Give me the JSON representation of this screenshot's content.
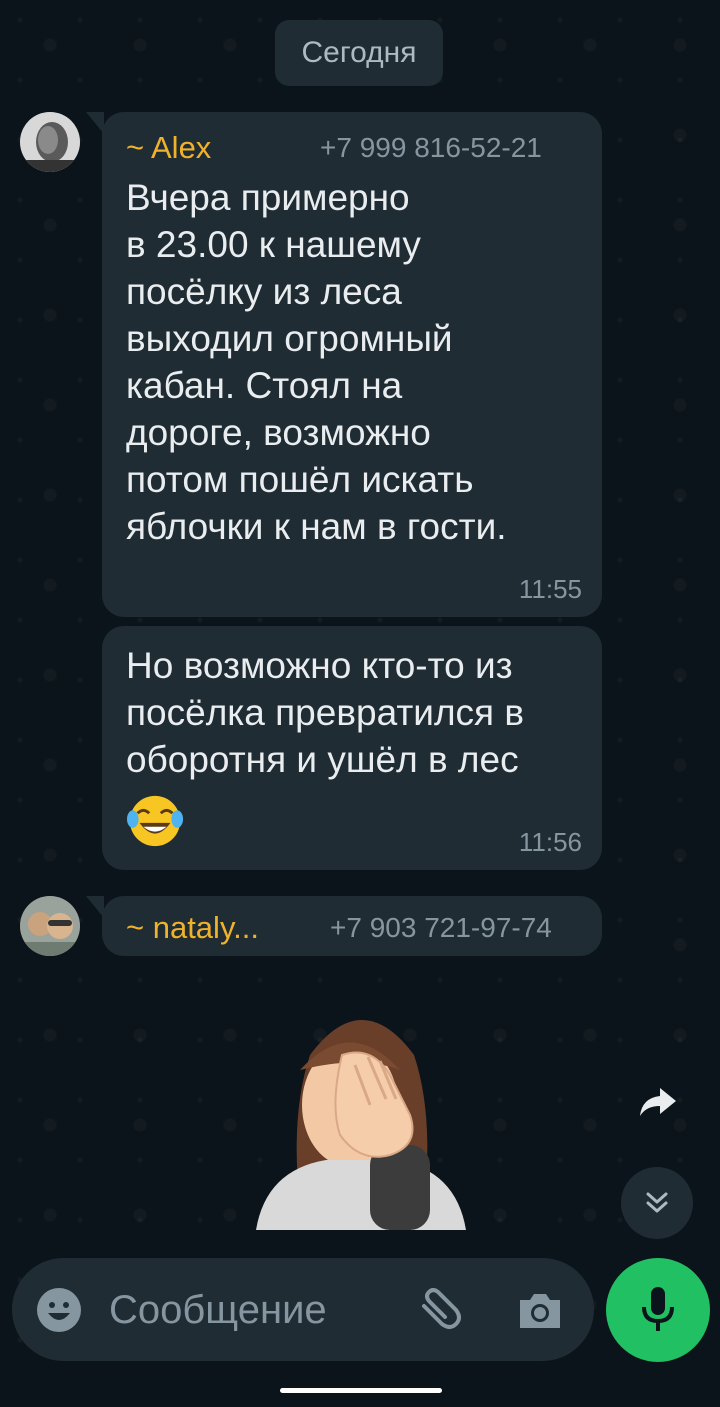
{
  "date_divider": "Сегодня",
  "messages": [
    {
      "sender": "~ Alex",
      "phone": "+7 999 816-52-21",
      "text": "Вчера примерно\nв 23.00 к нашему\nпосёлку из леса\nвыходил огромный\nкабан. Стоял на\nдороге, возможно\nпотом пошёл искать\nяблочки к нам в гости.",
      "time": "11:55"
    },
    {
      "text": "Но возможно кто-то из\nпосёлка превратился в\nоборотня и ушёл в лес",
      "emoji": "face-with-tears-of-joy",
      "time": "11:56"
    },
    {
      "sender": "~ nataly...",
      "phone": "+7 903 721-97-74",
      "sticker": "facepalm-woman-sticker"
    }
  ],
  "input": {
    "placeholder": "Сообщение"
  },
  "colors": {
    "background": "#0b141a",
    "bubble": "#202c33",
    "sender": "#f0b22a",
    "accent": "#21c063",
    "muted": "#8696a0"
  }
}
